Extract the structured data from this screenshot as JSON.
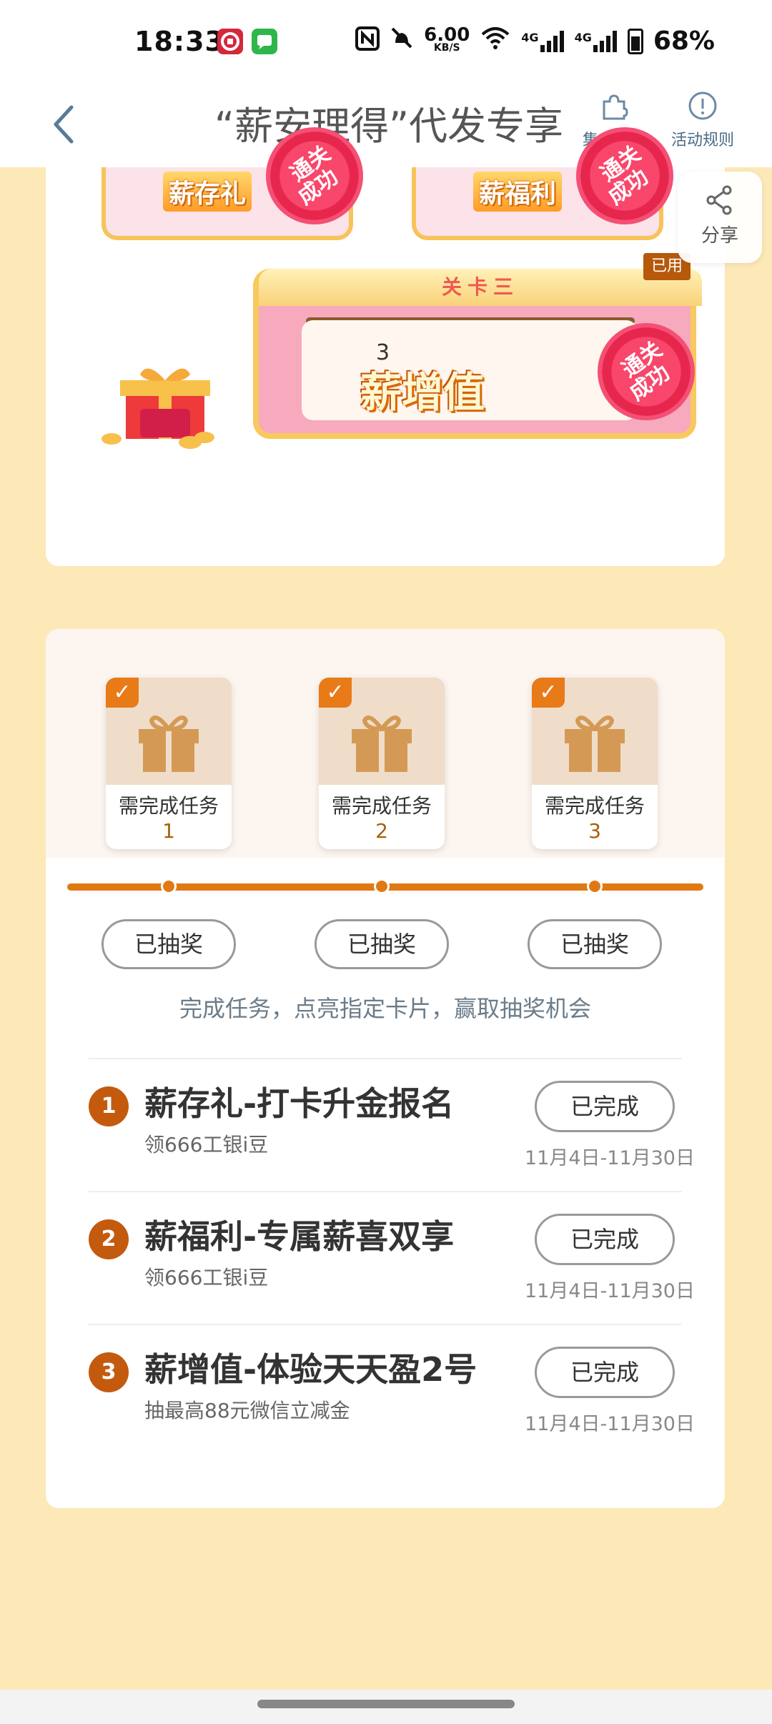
{
  "status_bar": {
    "time": "18:33",
    "net_speed_value": "6.00",
    "net_speed_unit": "KB/S",
    "signal1_label": "4G",
    "signal2_label": "4G",
    "battery": "68%"
  },
  "header": {
    "title": "“薪安理得”代发专享",
    "actions": [
      {
        "label": "集卡明细",
        "icon": "puzzle-icon"
      },
      {
        "label": "活动规则",
        "icon": "info-icon"
      }
    ]
  },
  "share": {
    "label": "分享",
    "icon": "share-icon"
  },
  "stages": {
    "top_left_label": "薪存礼",
    "top_right_label": "薪福利",
    "badge_text_line1": "通关",
    "badge_text_line2": "成功",
    "stage3_header": "关卡三",
    "stage3_number": "3",
    "stage3_name": "薪增值",
    "used_tag": "已用"
  },
  "gift_cards": [
    {
      "text": "需完成任务",
      "num": "1",
      "draw_label": "已抽奖"
    },
    {
      "text": "需完成任务",
      "num": "2",
      "draw_label": "已抽奖"
    },
    {
      "text": "需完成任务",
      "num": "3",
      "draw_label": "已抽奖"
    }
  ],
  "hint": "完成任务，点亮指定卡片，赢取抽奖机会",
  "tasks": [
    {
      "num": "1",
      "title": "薪存礼-打卡升金报名",
      "sub": "领666工银i豆",
      "status": "已完成",
      "date": "11月4日-11月30日"
    },
    {
      "num": "2",
      "title": "薪福利-专属薪喜双享",
      "sub": "领666工银i豆",
      "status": "已完成",
      "date": "11月4日-11月30日"
    },
    {
      "num": "3",
      "title": "薪增值-体验天天盈2号",
      "sub": "抽最高88元微信立减金",
      "status": "已完成",
      "date": "11月4日-11月30日"
    }
  ],
  "colors": {
    "accent": "#e07913",
    "page_bg": "#fde8b8",
    "task_num": "#c45a0e"
  }
}
